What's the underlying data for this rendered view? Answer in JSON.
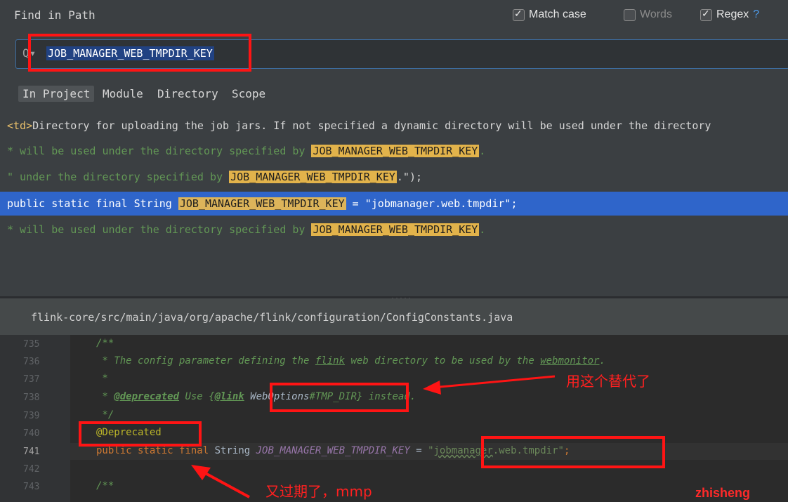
{
  "dialog": {
    "title": "Find in Path",
    "options": [
      {
        "label": "Match case",
        "checked": true
      },
      {
        "label": "Words",
        "checked": false
      },
      {
        "label": "Regex",
        "checked": true
      }
    ],
    "regex_help": "?"
  },
  "search": {
    "value": "JOB_MANAGER_WEB_TMPDIR_KEY"
  },
  "scopes": [
    "In Project",
    "Module",
    "Directory",
    "Scope"
  ],
  "results": [
    {
      "pre": "",
      "tag": "<td>",
      "text": "Directory for uploading the job jars. If not specified a dynamic directory will be used under the directory",
      "match": "",
      "post": ""
    },
    {
      "pre": "* will be used under the directory specified by ",
      "match": "JOB_MANAGER_WEB_TMPDIR_KEY",
      "post": "."
    },
    {
      "pre": "\" under the directory specified by ",
      "match": "JOB_MANAGER_WEB_TMPDIR_KEY",
      "post": ".\");"
    },
    {
      "pre": "public static final String ",
      "match": "JOB_MANAGER_WEB_TMPDIR_KEY",
      "post": " = \"jobmanager.web.tmpdir\";"
    },
    {
      "pre": "* will be used under the directory specified by ",
      "match": "JOB_MANAGER_WEB_TMPDIR_KEY",
      "post": "."
    }
  ],
  "file_path": "flink-core/src/main/java/org/apache/flink/configuration/ConfigConstants.java",
  "separator": ".....",
  "editor": {
    "line_numbers": [
      "735",
      "736",
      "737",
      "738",
      "739",
      "740",
      "741",
      "742",
      "743"
    ],
    "lines": {
      "l735": "/**",
      "l736a": " * The config parameter defining the ",
      "l736b": "flink",
      "l736c": " web directory to be used by the ",
      "l736d": "webmonitor",
      "l736e": ".",
      "l737": " *",
      "l738a": " * ",
      "l738b": "@deprecated",
      "l738c": " Use {",
      "l738d": "@link",
      "l738e": " WebOptions",
      "l738f": "#TMP_DIR",
      "l738g": "}",
      "l738h": " instead.",
      "l739": " */",
      "l740": "@Deprecated",
      "l741a": "public static ",
      "l741b": "final",
      "l741c": " String ",
      "l741d": "JOB_MANAGER_WEB_TMPDIR_KEY",
      "l741e": " = ",
      "l741f": "\"",
      "l741g": "jobmanager",
      "l741h": ".web.tmpdir\"",
      "l741i": ";",
      "l743": "/**"
    }
  },
  "annotations": {
    "replace_note": "用这个替代了",
    "expired_note": "又过期了，mmp",
    "watermark": "zhisheng"
  },
  "colors": {
    "annotation_red": "#ff1414",
    "selection_blue": "#2f65ca",
    "match_highlight": "#e2b34b"
  }
}
